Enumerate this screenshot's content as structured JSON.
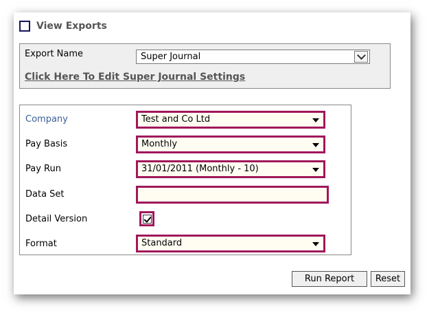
{
  "header": {
    "title": "View Exports"
  },
  "export": {
    "label": "Export Name",
    "selected": "Super Journal",
    "edit_link": "Click Here To Edit Super Journal Settings"
  },
  "form": {
    "company": {
      "label": "Company",
      "value": "Test and Co Ltd"
    },
    "pay_basis": {
      "label": "Pay Basis",
      "value": "Monthly"
    },
    "pay_run": {
      "label": "Pay Run",
      "value": "31/01/2011 (Monthly - 10)"
    },
    "data_set": {
      "label": "Data Set",
      "value": ""
    },
    "detail_version": {
      "label": "Detail Version",
      "checked": true
    },
    "format": {
      "label": "Format",
      "value": "Standard"
    }
  },
  "buttons": {
    "run": "Run Report",
    "reset": "Reset"
  },
  "colors": {
    "highlight": "#a0175a",
    "company_label": "#3a5f96",
    "header_box": "#14145a"
  }
}
